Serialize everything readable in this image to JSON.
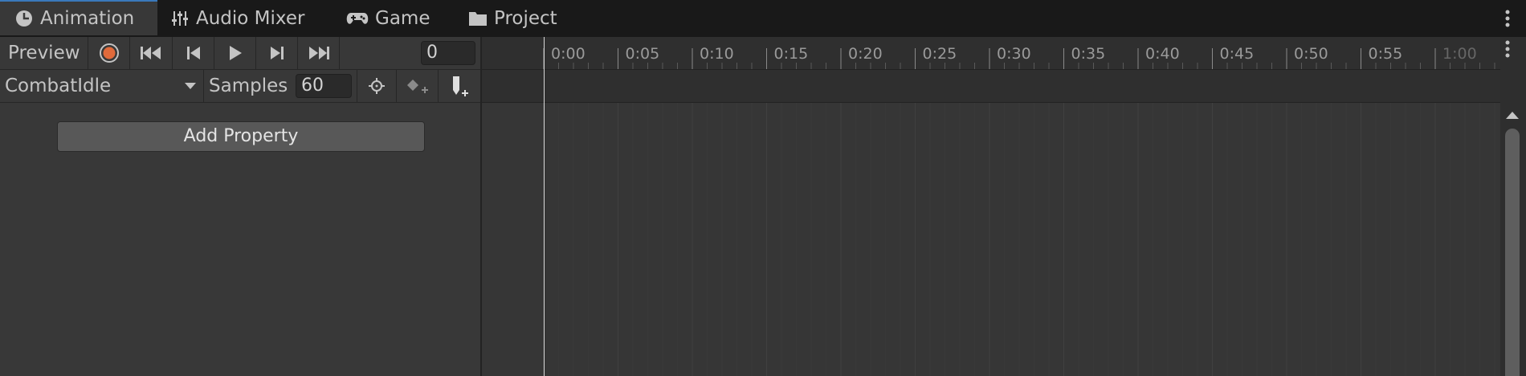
{
  "tabs": [
    {
      "label": "Animation",
      "icon": "animation-clock-icon",
      "active": true
    },
    {
      "label": "Audio Mixer",
      "icon": "sliders-icon",
      "active": false
    },
    {
      "label": "Game",
      "icon": "gamepad-icon",
      "active": false
    },
    {
      "label": "Project",
      "icon": "folder-icon",
      "active": false
    }
  ],
  "toolbar": {
    "preview_label": "Preview",
    "frame_value": "0",
    "clip_name": "CombatIdle",
    "samples_label": "Samples",
    "samples_value": "60"
  },
  "add_property_label": "Add Property",
  "timeline": {
    "labels": [
      "0:00",
      "0:05",
      "0:10",
      "0:15",
      "0:20",
      "0:25",
      "0:30",
      "0:35",
      "0:40",
      "0:45",
      "0:50",
      "0:55",
      "1:00"
    ]
  },
  "colors": {
    "record": "#e06a3b",
    "active_tab_accent": "#3a79bb",
    "panel_bg": "#383838",
    "tabbar_bg": "#191919"
  }
}
